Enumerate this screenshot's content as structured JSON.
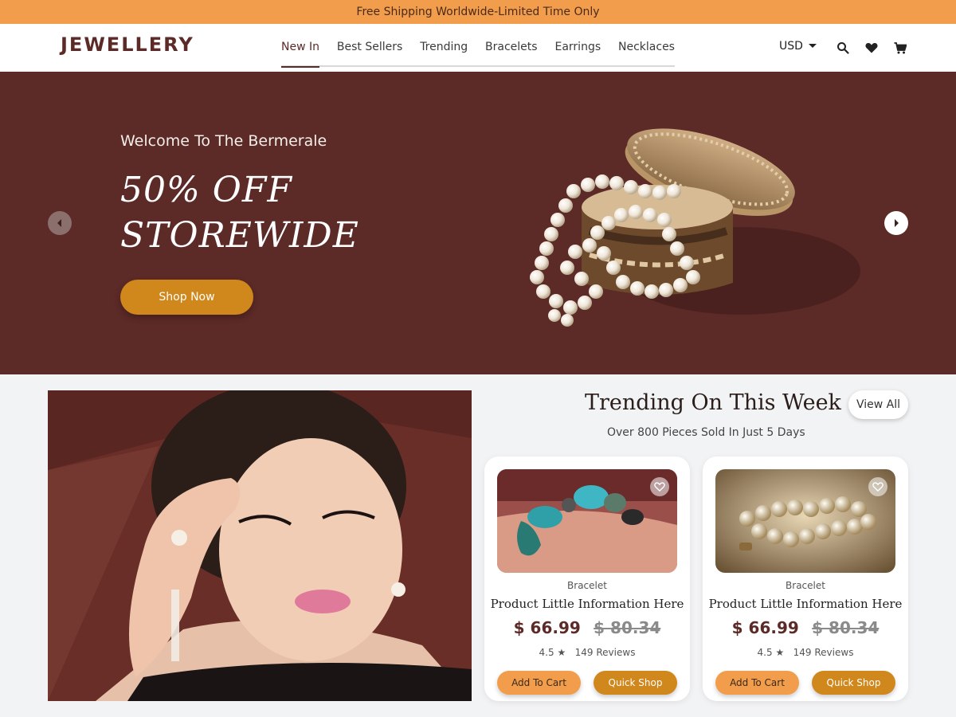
{
  "announcement": "Free Shipping Worldwide-Limited Time Only",
  "brand": "JEWELLERY",
  "nav": [
    {
      "label": "New In",
      "active": true
    },
    {
      "label": "Best Sellers",
      "active": false
    },
    {
      "label": "Trending",
      "active": false
    },
    {
      "label": "Bracelets",
      "active": false
    },
    {
      "label": "Earrings",
      "active": false
    },
    {
      "label": "Necklaces",
      "active": false
    }
  ],
  "header": {
    "currency": "USD",
    "icons": [
      "search-icon",
      "heart-icon",
      "cart-icon"
    ]
  },
  "hero": {
    "welcome": "Welcome To The Bermerale",
    "title_line1": "50% OFF",
    "title_line2": "STOREWIDE",
    "cta": "Shop Now"
  },
  "trending": {
    "title": "Trending On This Week",
    "subtitle": "Over 800 Pieces Sold In Just 5 Days",
    "view_all": "View All",
    "products": [
      {
        "category": "Bracelet",
        "name": "Product Little Information Here",
        "price": "$ 66.99",
        "old_price": "$ 80.34",
        "rating": "4.5 ★",
        "reviews": "149 Reviews",
        "add_to_cart": "Add To Cart",
        "quick_shop": "Quick Shop"
      },
      {
        "category": "Bracelet",
        "name": "Product Little Information Here",
        "price": "$ 66.99",
        "old_price": "$ 80.34",
        "rating": "4.5 ★",
        "reviews": "149 Reviews",
        "add_to_cart": "Add To Cart",
        "quick_shop": "Quick Shop"
      }
    ]
  },
  "colors": {
    "brand": "#5c2a27",
    "accent": "#f29d4b",
    "cta": "#d0871b",
    "page_bg": "#f2f3f5"
  }
}
